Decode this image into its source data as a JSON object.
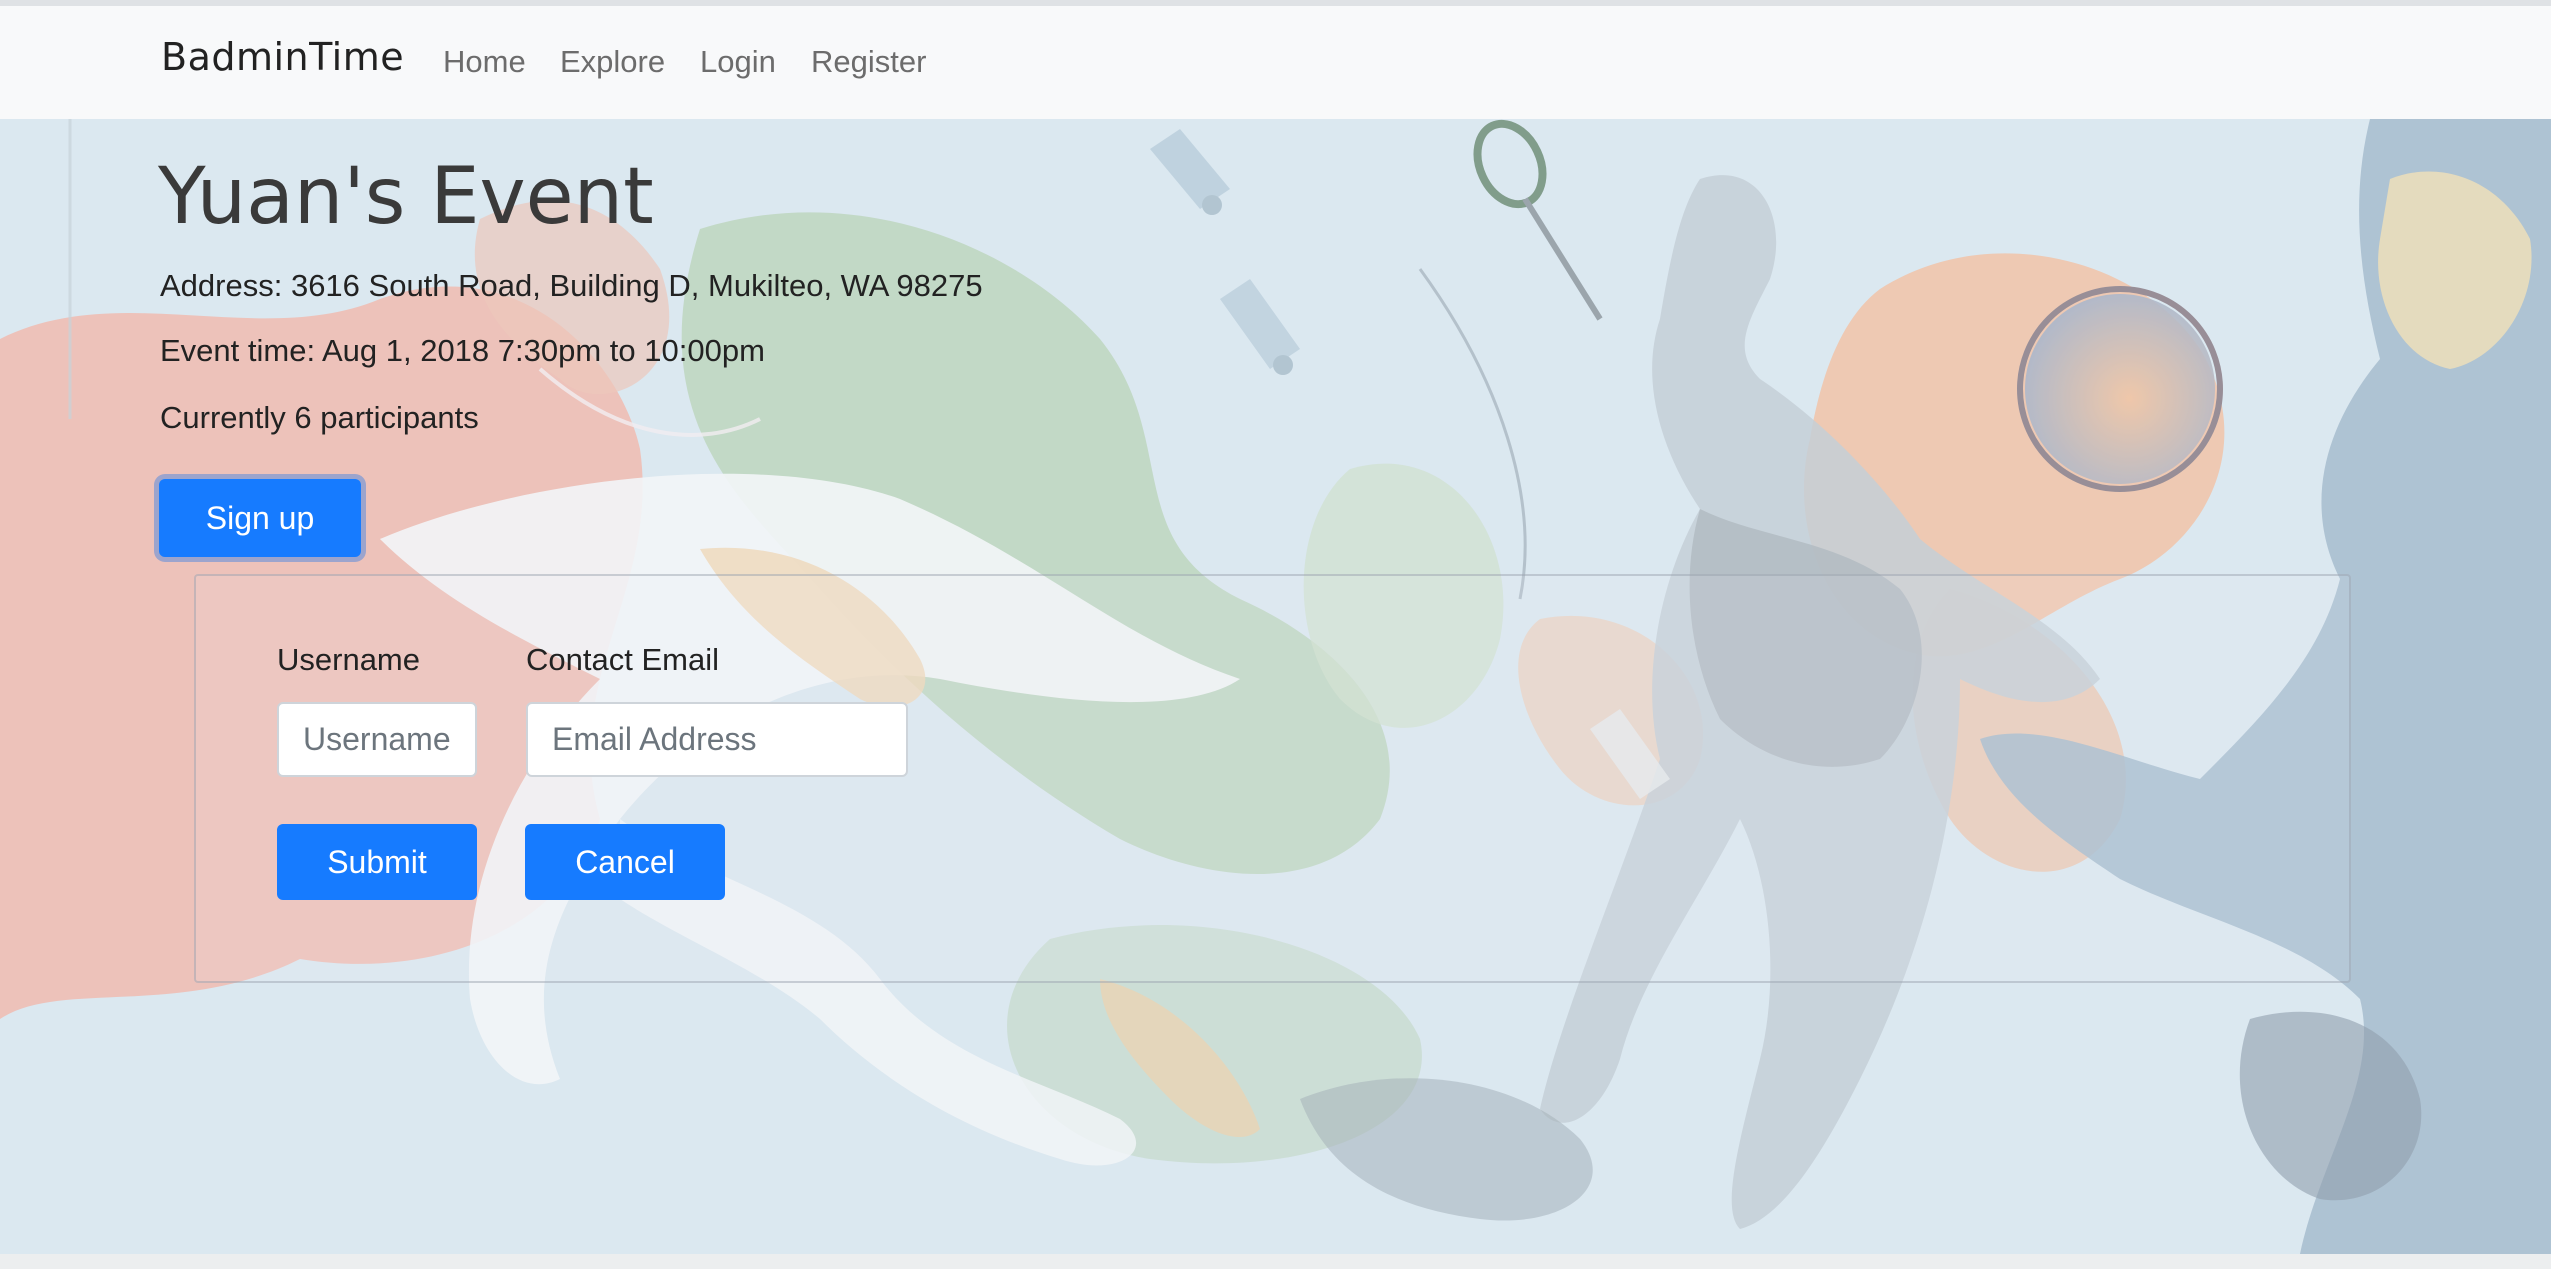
{
  "nav": {
    "brand": "BadminTime",
    "links": [
      "Home",
      "Explore",
      "Login",
      "Register"
    ]
  },
  "event": {
    "title": "Yuan's Event",
    "address": "Address: 3616 South Road, Building D, Mukilteo, WA 98275",
    "time": "Event time: Aug 1, 2018 7:30pm to 10:00pm",
    "participants": "Currently 6 participants"
  },
  "signup_button": "Sign up",
  "form": {
    "username_label": "Username",
    "username_placeholder": "Username",
    "username_value": "",
    "email_label": "Contact Email",
    "email_placeholder": "Email Address",
    "email_value": "",
    "submit_label": "Submit",
    "cancel_label": "Cancel"
  },
  "colors": {
    "primary": "#167bff",
    "navbar_bg": "#f8f9fa"
  },
  "icons": {
    "background": "badminton-players-illustration"
  }
}
